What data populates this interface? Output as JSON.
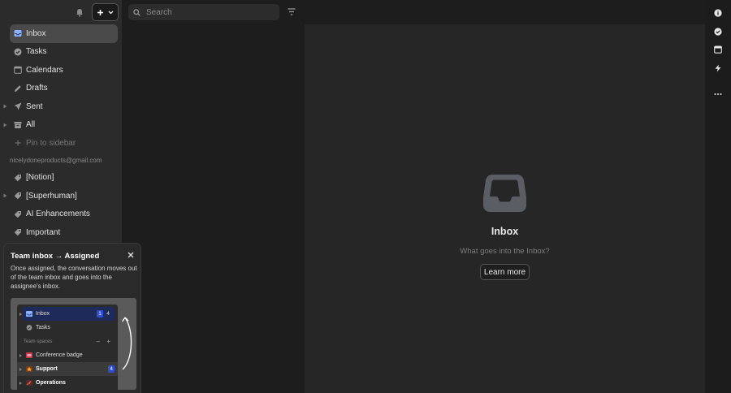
{
  "sidebar": {
    "items": [
      {
        "label": "Inbox",
        "icon": "inbox-icon"
      },
      {
        "label": "Tasks",
        "icon": "check-circle-icon"
      },
      {
        "label": "Calendars",
        "icon": "calendar-icon"
      },
      {
        "label": "Drafts",
        "icon": "pencil-icon"
      },
      {
        "label": "Sent",
        "icon": "paper-plane-icon"
      },
      {
        "label": "All",
        "icon": "archive-icon"
      },
      {
        "label": "Pin to sidebar",
        "icon": "plus-icon"
      }
    ],
    "account": "nicelydoneproducts@gmail.com",
    "labels": [
      {
        "label": "[Notion]",
        "icon": "tag-icon"
      },
      {
        "label": "[Superhuman]",
        "icon": "tag-icon"
      },
      {
        "label": "AI Enhancements",
        "icon": "tag-icon"
      },
      {
        "label": "Important",
        "icon": "tag-icon"
      }
    ]
  },
  "popover": {
    "title": "Team inbox → Assigned",
    "body": "Once assigned, the conversation moves out of the team inbox and goes into the assignee's inbox.",
    "preview": {
      "inbox_label": "Inbox",
      "inbox_badge_count": "1",
      "inbox_count": "4",
      "tasks_label": "Tasks",
      "section_label": "Team spaces",
      "section_controls": "– +",
      "conference_label": "Conference badge",
      "support_label": "Support",
      "support_badge": "4",
      "operations_label": "Operations"
    }
  },
  "search": {
    "placeholder": "Search"
  },
  "main": {
    "empty_title": "Inbox",
    "empty_subtitle": "What goes into the Inbox?",
    "learn_more": "Learn more"
  },
  "rail": {
    "icons": [
      "info-icon",
      "check-circle-icon",
      "calendar-icon",
      "lightning-icon",
      "more-icon"
    ]
  },
  "colors": {
    "accent_blue": "#2f4fd0",
    "selected_bg": "#4a4a4a",
    "sidebar_bg": "#2b2b2b"
  }
}
